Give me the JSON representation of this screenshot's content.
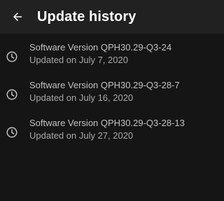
{
  "header": {
    "title": "Update history",
    "back_icon": "arrow-back-icon"
  },
  "history": {
    "icon": "clock-icon",
    "items": [
      {
        "title": "Software Version QPH30.29-Q3-24",
        "subtitle": "Updated on July 7, 2020"
      },
      {
        "title": "Software Version QPH30.29-Q3-28-7",
        "subtitle": "Updated on July 16, 2020"
      },
      {
        "title": "Software Version QPH30.29-Q3-28-13",
        "subtitle": "Updated on July 27, 2020"
      }
    ]
  },
  "colors": {
    "background": "#151515",
    "app_bar": "#212121",
    "title_text": "#ffffff",
    "primary_text": "#c2c2c2",
    "secondary_text": "#a8a8a8"
  }
}
